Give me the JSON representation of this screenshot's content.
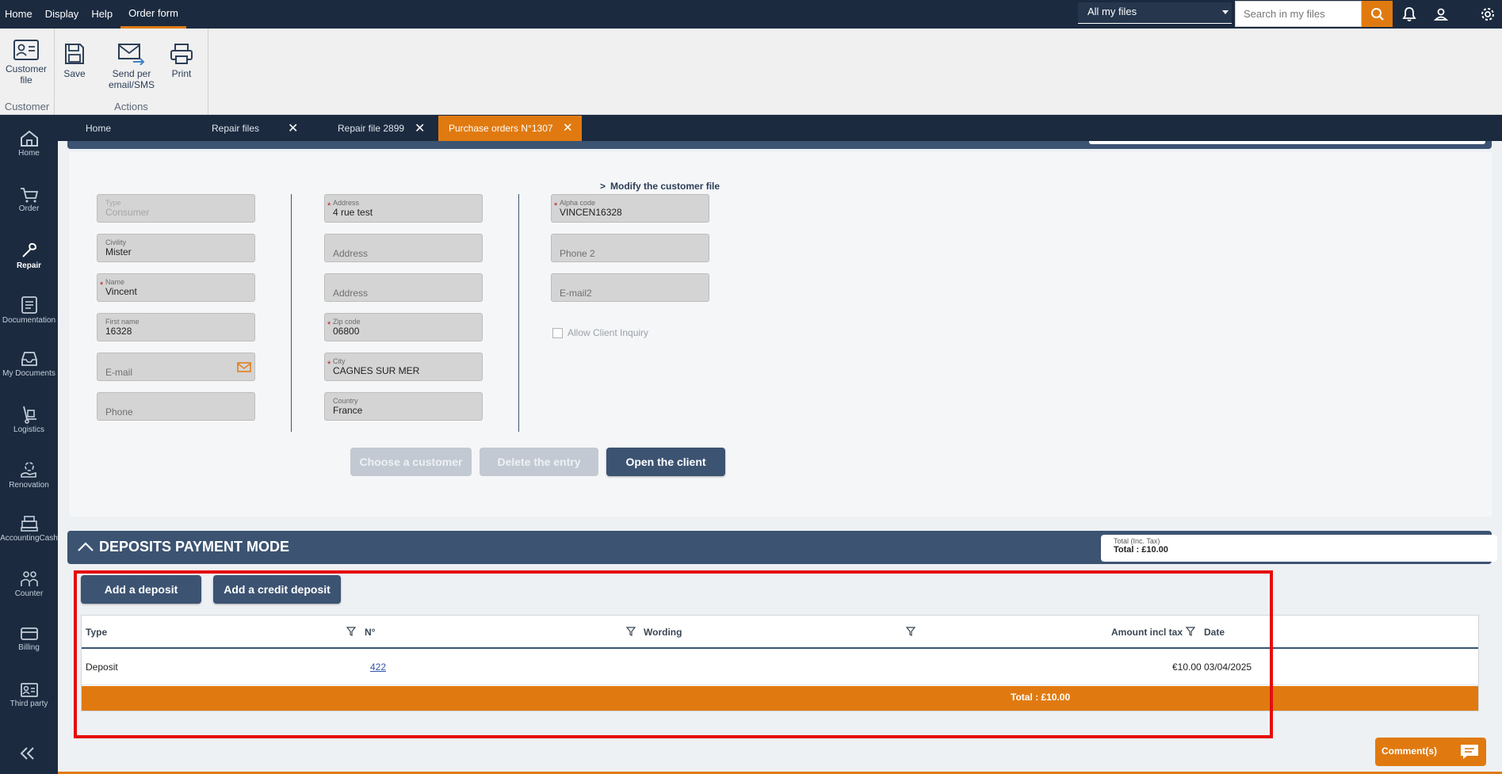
{
  "topmenu": [
    "Home",
    "Display",
    "Help",
    "Order form"
  ],
  "topbar": {
    "scope": "All my files",
    "search_placeholder": "Search in my files"
  },
  "ribbon": {
    "customer_group_label": "Customer",
    "customer_file_label": "Customer file",
    "actions_group_label": "Actions",
    "save_label": "Save",
    "send_label": "Send per email/SMS",
    "print_label": "Print"
  },
  "nav": [
    "Home",
    "Order",
    "Repair",
    "Documentation",
    "My Documents",
    "Logistics",
    "Renovation",
    "AccountingCash",
    "Counter",
    "Billing",
    "Third party"
  ],
  "tabs": [
    "Home",
    "Repair files",
    "Repair file 2899",
    "Purchase orders N°1307"
  ],
  "customer": {
    "modify_link": "Modify the customer file",
    "type_label": "Type",
    "type_value": "Consumer",
    "civility_label": "Civility",
    "civility_value": "Mister",
    "name_label": "Name",
    "name_value": "Vincent",
    "firstname_label": "First name",
    "firstname_value": "16328",
    "email_placeholder": "E-mail",
    "phone_placeholder": "Phone",
    "address_label": "Address",
    "address_value": "4 rue test",
    "address2_placeholder": "Address",
    "address3_placeholder": "Address",
    "zip_label": "Zip code",
    "zip_value": "06800",
    "city_label": "City",
    "city_value": "CAGNES SUR MER",
    "country_label": "Country",
    "country_value": "France",
    "alpha_label": "Alpha code",
    "alpha_value": "VINCEN16328",
    "phone2_placeholder": "Phone 2",
    "email2_placeholder": "E-mail2",
    "allow_inquiry_label": "Allow Client Inquiry",
    "choose_customer": "Choose a customer",
    "delete_entry": "Delete the entry",
    "open_client": "Open the client"
  },
  "deposits": {
    "title": "DEPOSITS PAYMENT MODE",
    "total_label": "Total (Inc. Tax)",
    "total_value": "Total : £10.00",
    "add_deposit": "Add a deposit",
    "add_credit_deposit": "Add a credit deposit",
    "columns": [
      "Type",
      "N°",
      "Wording",
      "Amount incl tax",
      "Date"
    ],
    "rows": [
      {
        "type": "Deposit",
        "number": "422",
        "wording": "",
        "amount": "€10.00",
        "date": "03/04/2025"
      }
    ],
    "grid_total": "Total : £10.00"
  },
  "comments_label": "Comment(s)",
  "colors": {
    "accent": "#e07a10",
    "navy": "#1b2a3f",
    "section": "#3c5372",
    "highlight": "#e50c0c"
  }
}
